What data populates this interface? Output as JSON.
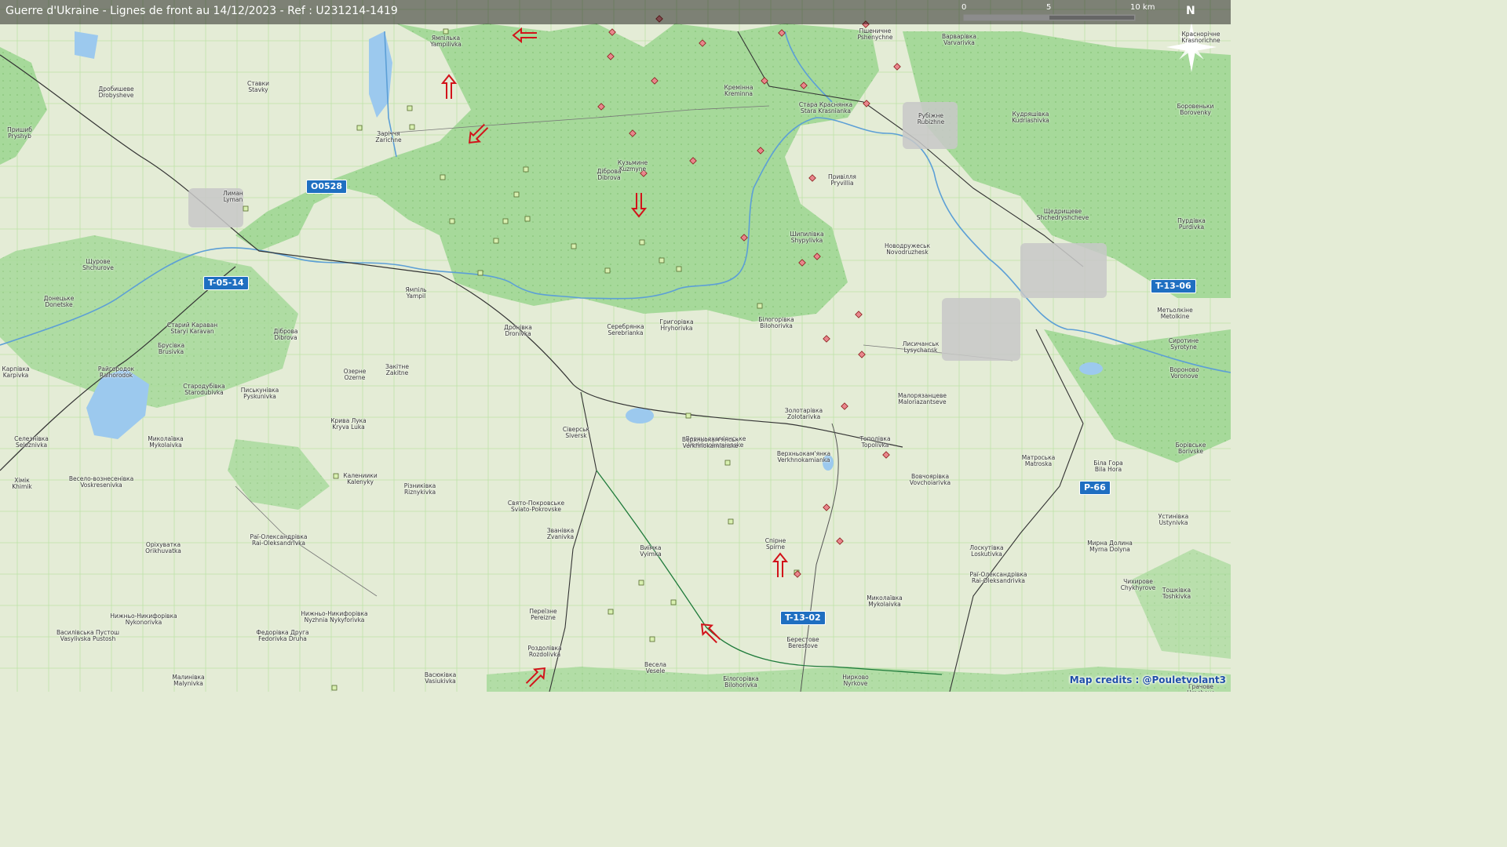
{
  "title": "Guerre d'Ukraine - Lignes de front au 14/12/2023 - Ref : U231214-1419",
  "credits": "Map credits : @Pouletvolant3",
  "scale": {
    "labels": [
      "0",
      "5",
      "10 km"
    ]
  },
  "compass": {
    "label": "N"
  },
  "road_shields": [
    "O0528",
    "T-05-14",
    "T-13-06",
    "P-66",
    "T-13-02"
  ],
  "places": [
    {
      "ua": "Ямпілька",
      "lat": "Yampilivka"
    },
    {
      "ua": "Заріччя",
      "lat": "Zarichne"
    },
    {
      "ua": "Дробишеве",
      "lat": "Drobysheve"
    },
    {
      "ua": "Ставки",
      "lat": "Stavky"
    },
    {
      "ua": "Пришиб",
      "lat": "Pryshyb"
    },
    {
      "ua": "Лиман",
      "lat": "Lyman"
    },
    {
      "ua": "Щурове",
      "lat": "Shchurove"
    },
    {
      "ua": "Донецьке",
      "lat": "Donetske"
    },
    {
      "ua": "Старий Караван",
      "lat": "Staryi Karavan"
    },
    {
      "ua": "Брусівка",
      "lat": "Brusivka"
    },
    {
      "ua": "Діброва",
      "lat": "Dibrova"
    },
    {
      "ua": "Ямпіль",
      "lat": "Yampil"
    },
    {
      "ua": "Райгородок",
      "lat": "Raihorodok"
    },
    {
      "ua": "Карпівка",
      "lat": "Karpivka"
    },
    {
      "ua": "Стародубівка",
      "lat": "Starodubivka"
    },
    {
      "ua": "Писькунівка",
      "lat": "Pyskunivka"
    },
    {
      "ua": "Закітне",
      "lat": "Zakitne"
    },
    {
      "ua": "Озерне",
      "lat": "Ozerne"
    },
    {
      "ua": "Дронівка",
      "lat": "Dronivka"
    },
    {
      "ua": "Кузьмине",
      "lat": "Kuzmyne"
    },
    {
      "ua": "Діброва",
      "lat": "Dibrova"
    },
    {
      "ua": "Кремінна",
      "lat": "Kreminna"
    },
    {
      "ua": "Стара Краснянка",
      "lat": "Stara Krasnianka"
    },
    {
      "ua": "Пшеничне",
      "lat": "Pshenychne"
    },
    {
      "ua": "Варварівка",
      "lat": "Varvarivka"
    },
    {
      "ua": "Рубіжне",
      "lat": "Rubizhne"
    },
    {
      "ua": "Кудряшівка",
      "lat": "Kudriashivka"
    },
    {
      "ua": "Боровеньки",
      "lat": "Borovenky"
    },
    {
      "ua": "Привілля",
      "lat": "Pryvillia"
    },
    {
      "ua": "Шипилівка",
      "lat": "Shypylivka"
    },
    {
      "ua": "Новодружеськ",
      "lat": "Novodruzhesk"
    },
    {
      "ua": "Щедрищеве",
      "lat": "Shchedryshcheve"
    },
    {
      "ua": "Пурдівка",
      "lat": "Purdivka"
    },
    {
      "ua": "Серебрянка",
      "lat": "Serebrianka"
    },
    {
      "ua": "Григорівка",
      "lat": "Hryhorivka"
    },
    {
      "ua": "Білогорівка",
      "lat": "Bilohorivka"
    },
    {
      "ua": "Лисичанськ",
      "lat": "Lysychansk"
    },
    {
      "ua": "Метьолкіне",
      "lat": "Metolkine"
    },
    {
      "ua": "Сиротине",
      "lat": "Syrotyne"
    },
    {
      "ua": "Вороново",
      "lat": "Voronove"
    },
    {
      "ua": "Золотарівка",
      "lat": "Zolotarivka"
    },
    {
      "ua": "Малорязанцеве",
      "lat": "Malorіazantseve"
    },
    {
      "ua": "Кривa Лука",
      "lat": "Kryva Luka"
    },
    {
      "ua": "Сіверськ",
      "lat": "Siversk"
    },
    {
      "ua": "Верхньокам'янське",
      "lat": "Verkhnokamianske"
    },
    {
      "ua": "Верхньокам'янка",
      "lat": "Verkhnokamianka"
    },
    {
      "ua": "Тополівка",
      "lat": "Topolivka"
    },
    {
      "ua": "Вовчоярівка",
      "lat": "Vovchoiarivka"
    },
    {
      "ua": "Біла Гора",
      "lat": "Bila Hora"
    },
    {
      "ua": "Борівське",
      "lat": "Borivske"
    },
    {
      "ua": "Миколаївка",
      "lat": "Mykolaivka"
    },
    {
      "ua": "Селезнівка",
      "lat": "Seleznivka"
    },
    {
      "ua": "Весело-вознесенівка",
      "lat": "Voskresenivka"
    },
    {
      "ua": "Калениики",
      "lat": "Kalenyky"
    },
    {
      "ua": "Різниківка",
      "lat": "Riznykivka"
    },
    {
      "ua": "Хімік",
      "lat": "Khimik"
    },
    {
      "ua": "Святo-Покровське",
      "lat": "Sviato-Pokrovske"
    },
    {
      "ua": "Званівка",
      "lat": "Zvanivka"
    },
    {
      "ua": "Раї-Олександрівка",
      "lat": "Rai-Oleksandrivka"
    },
    {
      "ua": "Оріхуватка",
      "lat": "Orikhuvatka"
    },
    {
      "ua": "Виїмка",
      "lat": "Vyimka"
    },
    {
      "ua": "Спірне",
      "lat": "Spirne"
    },
    {
      "ua": "Матроська",
      "lat": "Matroska"
    },
    {
      "ua": "Устинівка",
      "lat": "Ustynivka"
    },
    {
      "ua": "Мирна Долина",
      "lat": "Myrna Dolyna"
    },
    {
      "ua": "Лоскутівка",
      "lat": "Loskutivka"
    },
    {
      "ua": "Раї-Олександрівка",
      "lat": "Rai-Oleksandrivka"
    },
    {
      "ua": "Чихирове",
      "lat": "Chykhyrove"
    },
    {
      "ua": "Тошківка",
      "lat": "Toshkivka"
    },
    {
      "ua": "Нижньо-Никифорівка",
      "lat": "Nykonorivka"
    },
    {
      "ua": "Нижньо-Никифорівка",
      "lat": "Nyzhnia Nykyforivka"
    },
    {
      "ua": "Федорівка Друга",
      "lat": "Fedorivka Druha"
    },
    {
      "ua": "Василівська Пустош",
      "lat": "Vasylivska Pustosh"
    },
    {
      "ua": "Переїзне",
      "lat": "Pereizne"
    },
    {
      "ua": "Роздолівка",
      "lat": "Rozdolivka"
    },
    {
      "ua": "Весела",
      "lat": "Vesele"
    },
    {
      "ua": "Миколаївка",
      "lat": "Mykolaivka"
    },
    {
      "ua": "Берестове",
      "lat": "Berestove"
    },
    {
      "ua": "Білогорівка",
      "lat": "Bilohorivka"
    },
    {
      "ua": "Нирково",
      "lat": "Nyrkove"
    },
    {
      "ua": "Малинівка",
      "lat": "Malynivka"
    },
    {
      "ua": "Васюківка",
      "lat": "Vasiukivka"
    },
    {
      "ua": "Верхньокам'янськ",
      "lat": "Verkhnokamianske"
    },
    {
      "ua": "Грачове",
      "lat": "Hrachove"
    },
    {
      "ua": "Краснорічне",
      "lat": "Krasnorichne"
    }
  ],
  "colors": {
    "background": "#e4ecd6",
    "forest": "#a6d99a",
    "water": "#9cc9ee",
    "river": "#5c9fd6",
    "road_shield": "#1f6fc1",
    "arrow": "#d2131a",
    "unit_green": "#d8f0b0",
    "unit_red": "#e8868c"
  },
  "arrows": [
    {
      "direction": "west"
    },
    {
      "direction": "north"
    },
    {
      "direction": "south-west"
    },
    {
      "direction": "south"
    },
    {
      "direction": "north"
    },
    {
      "direction": "north-west"
    },
    {
      "direction": "north-east"
    }
  ]
}
